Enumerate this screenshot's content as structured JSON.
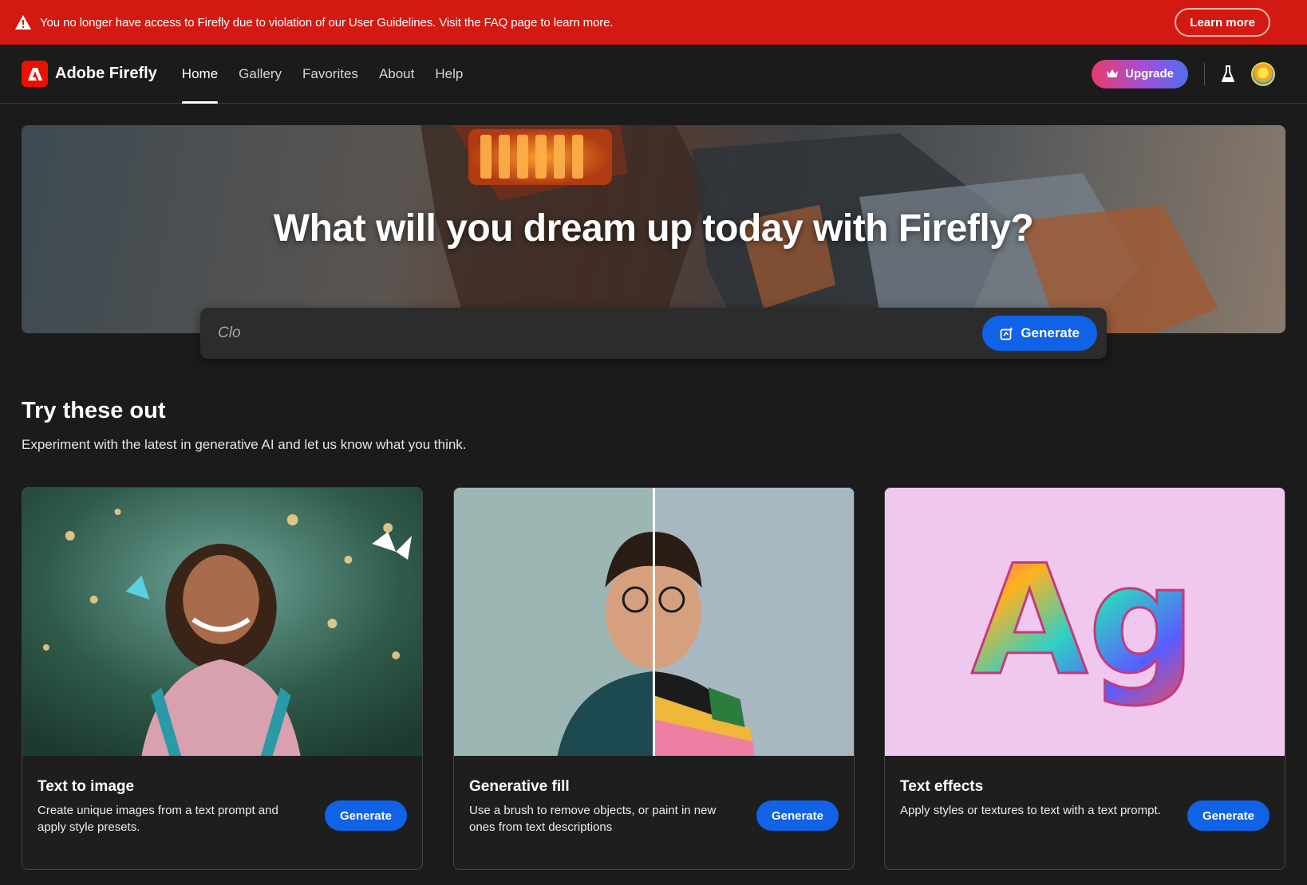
{
  "alert": {
    "message": "You no longer have access to Firefly due to violation of our User Guidelines. Visit the FAQ page to learn more.",
    "action_label": "Learn more",
    "color": "#d31a12"
  },
  "nav": {
    "brand": "Adobe Firefly",
    "items": [
      {
        "label": "Home",
        "active": true
      },
      {
        "label": "Gallery",
        "active": false
      },
      {
        "label": "Favorites",
        "active": false
      },
      {
        "label": "About",
        "active": false
      },
      {
        "label": "Help",
        "active": false
      }
    ],
    "upgrade_label": "Upgrade",
    "icons": [
      "crown-icon",
      "flask-icon",
      "avatar"
    ]
  },
  "hero": {
    "title": "What will you dream up today with Firefly?",
    "prompt_value": "Clo",
    "generate_label": "Generate"
  },
  "section": {
    "title": "Try these out",
    "subtitle": "Experiment with the latest in generative AI and let us know what you think."
  },
  "cards": [
    {
      "title": "Text to image",
      "description": "Create unique images from a text prompt and apply style presets.",
      "button": "Generate"
    },
    {
      "title": "Generative fill",
      "description": "Use a brush to remove objects, or paint in new ones from text descriptions",
      "button": "Generate"
    },
    {
      "title": "Text effects",
      "description": "Apply styles or textures to text with a text prompt.",
      "button": "Generate",
      "image_text": "Ag"
    }
  ],
  "colors": {
    "primary_button": "#1062e6",
    "background": "#1b1b1b",
    "brand_red": "#eb1000"
  }
}
